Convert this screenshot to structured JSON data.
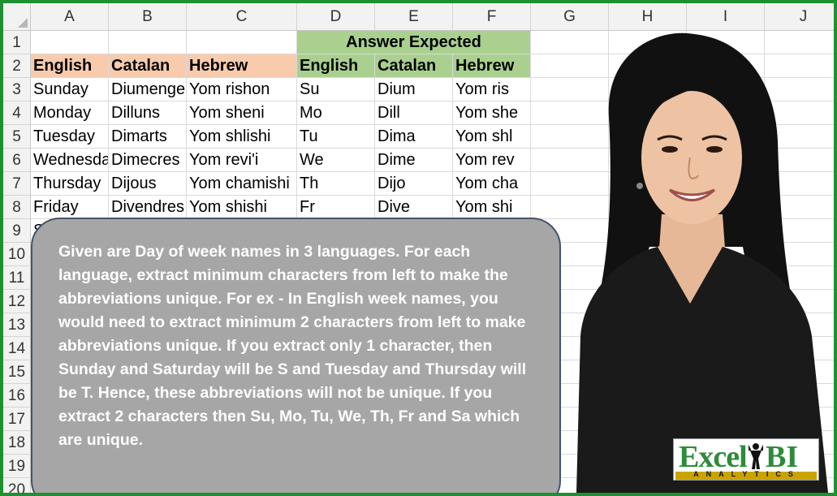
{
  "spreadsheet": {
    "columns": [
      "A",
      "B",
      "C",
      "D",
      "E",
      "F",
      "G",
      "H",
      "I",
      "J"
    ],
    "rows": [
      "1",
      "2",
      "3",
      "4",
      "5",
      "6",
      "7",
      "8",
      "9",
      "10",
      "11",
      "12",
      "13",
      "14",
      "15",
      "16",
      "17",
      "18",
      "19",
      "20"
    ],
    "merged_header": "Answer Expected",
    "headers_input": [
      "English",
      "Catalan",
      "Hebrew"
    ],
    "headers_answer": [
      "English",
      "Catalan",
      "Hebrew"
    ],
    "data": [
      [
        "Sunday",
        "Diumenge",
        "Yom rishon",
        "Su",
        "Dium",
        "Yom ris"
      ],
      [
        "Monday",
        "Dilluns",
        "Yom sheni",
        "Mo",
        "Dill",
        "Yom she"
      ],
      [
        "Tuesday",
        "Dimarts",
        "Yom shlishi",
        "Tu",
        "Dima",
        "Yom shl"
      ],
      [
        "Wednesday",
        "Dimecres",
        "Yom revi'i",
        "We",
        "Dime",
        "Yom rev"
      ],
      [
        "Thursday",
        "Dijous",
        "Yom chamishi",
        "Th",
        "Dijo",
        "Yom cha"
      ],
      [
        "Friday",
        "Divendres",
        "Yom shishi",
        "Fr",
        "Dive",
        "Yom shi"
      ]
    ],
    "row9_partial": "Sa"
  },
  "callout": {
    "text": "Given are Day of week names in 3 languages. For each language, extract minimum characters from left to make the abbreviations unique. For ex - In English week names, you would need to extract minimum 2 characters from left to make abbreviations unique. If you extract only 1 character, then Sunday and Saturday will be S and Tuesday and Thursday will be T. Hence, these abbreviations will not be unique. If you extract 2 characters then Su, Mo, Tu, We, Th, Fr and Sa which are unique."
  },
  "logo": {
    "word1": "Excel",
    "word2": "BI",
    "tagline": "ANALYTICS"
  },
  "colors": {
    "frame": "#1f8f2f",
    "header_orange": "#f8cbad",
    "header_green": "#a9d08e",
    "callout_fill": "#a6a6a6",
    "callout_border": "#44546a"
  }
}
